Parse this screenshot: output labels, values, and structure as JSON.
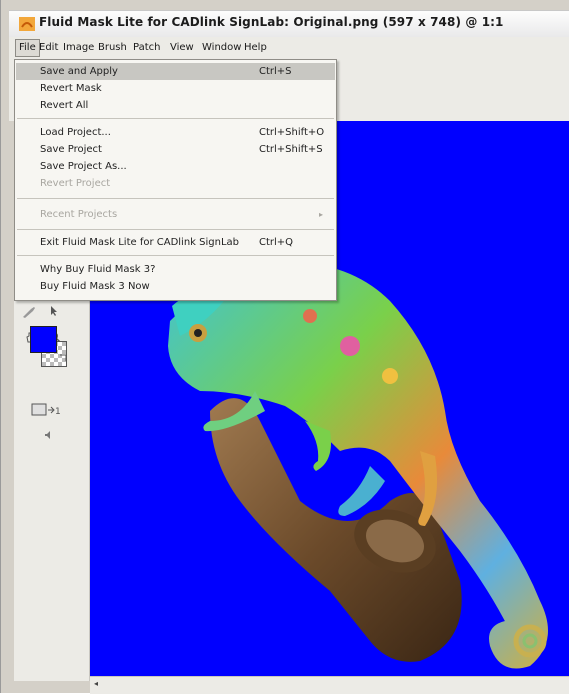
{
  "window": {
    "title": "Fluid Mask Lite for CADlink SignLab: Original.png (597 x 748) @ 1:1"
  },
  "menubar": {
    "items": [
      "File",
      "Edit",
      "Image",
      "Brush",
      "Patch",
      "View",
      "Window",
      "Help"
    ]
  },
  "file_menu": {
    "items": [
      {
        "label": "Save and Apply",
        "shortcut": "Ctrl+S",
        "enabled": true
      },
      {
        "label": "Revert Mask",
        "shortcut": "",
        "enabled": true
      },
      {
        "label": "Revert All",
        "shortcut": "",
        "enabled": true
      },
      {
        "label": "Load Project...",
        "shortcut": "Ctrl+Shift+O",
        "enabled": true
      },
      {
        "label": "Save Project",
        "shortcut": "Ctrl+Shift+S",
        "enabled": true
      },
      {
        "label": "Save Project As...",
        "shortcut": "",
        "enabled": true
      },
      {
        "label": "Revert Project",
        "shortcut": "",
        "enabled": false
      },
      {
        "label": "Recent Projects",
        "shortcut": "",
        "enabled": false,
        "submenu_arrow": "▸"
      },
      {
        "label": "Exit Fluid Mask Lite for CADlink SignLab",
        "shortcut": "Ctrl+Q",
        "enabled": true
      },
      {
        "label": "Why Buy Fluid Mask 3?",
        "shortcut": "",
        "enabled": true
      },
      {
        "label": "Buy Fluid Mask 3 Now",
        "shortcut": "",
        "enabled": true
      }
    ]
  },
  "colors": {
    "foreground": "#0000ff",
    "canvas_background": "#0000ff"
  },
  "tools": {
    "icons": [
      "brush-icon",
      "pointer-icon",
      "hand-icon",
      "zoom-icon",
      "swap-colors-icon",
      "zoom-fit-icon",
      "speaker-icon"
    ]
  }
}
